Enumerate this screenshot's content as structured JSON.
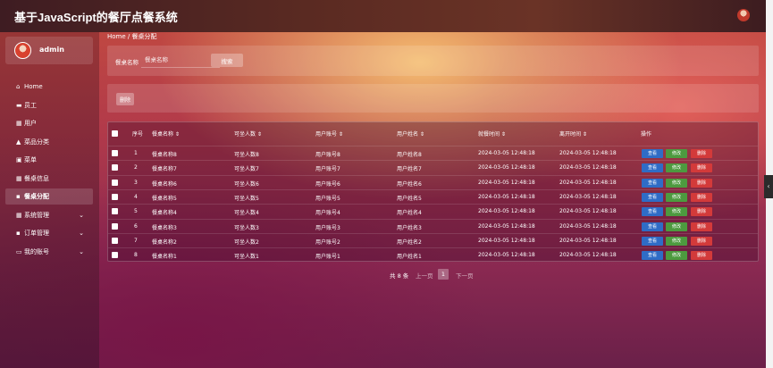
{
  "app": {
    "title": "基于JavaScript的餐厅点餐系统"
  },
  "user": {
    "name": "admin"
  },
  "sidebar": {
    "items": [
      {
        "label": "Home",
        "icon": "home-icon",
        "active": false,
        "expandable": false
      },
      {
        "label": "员工",
        "icon": "staff-icon",
        "active": false,
        "expandable": false
      },
      {
        "label": "用户",
        "icon": "grid-icon",
        "active": false,
        "expandable": false
      },
      {
        "label": "菜品分类",
        "icon": "category-icon",
        "active": false,
        "expandable": false
      },
      {
        "label": "菜单",
        "icon": "menu-icon",
        "active": false,
        "expandable": false
      },
      {
        "label": "餐桌信息",
        "icon": "grid-icon",
        "active": false,
        "expandable": false
      },
      {
        "label": "餐桌分配",
        "icon": "chat-icon",
        "active": true,
        "expandable": false
      },
      {
        "label": "系统管理",
        "icon": "grid-icon",
        "active": false,
        "expandable": true
      },
      {
        "label": "订单管理",
        "icon": "chat-icon",
        "active": false,
        "expandable": true
      },
      {
        "label": "我的账号",
        "icon": "account-icon",
        "active": false,
        "expandable": true
      }
    ]
  },
  "breadcrumb": "Home / 餐桌分配",
  "search": {
    "label": "餐桌名称",
    "placeholder": "餐桌名称",
    "button": "搜索"
  },
  "toolbar": {
    "delete_label": "删除"
  },
  "table": {
    "headers": [
      "序号",
      "餐桌名称 ⇕",
      "可坐人数 ⇕",
      "用户账号 ⇕",
      "用户姓名 ⇕",
      "就餐时间 ⇕",
      "离开时间 ⇕",
      "操作"
    ],
    "action_labels": {
      "view": "查看",
      "edit": "修改",
      "delete": "删除"
    },
    "rows": [
      [
        "1",
        "餐桌名称8",
        "可坐人数8",
        "用户账号8",
        "用户姓名8",
        "2024-03-05 12:48:18",
        "2024-03-05 12:48:18"
      ],
      [
        "2",
        "餐桌名称7",
        "可坐人数7",
        "用户账号7",
        "用户姓名7",
        "2024-03-05 12:48:18",
        "2024-03-05 12:48:18"
      ],
      [
        "3",
        "餐桌名称6",
        "可坐人数6",
        "用户账号6",
        "用户姓名6",
        "2024-03-05 12:48:18",
        "2024-03-05 12:48:18"
      ],
      [
        "4",
        "餐桌名称5",
        "可坐人数5",
        "用户账号5",
        "用户姓名5",
        "2024-03-05 12:48:18",
        "2024-03-05 12:48:18"
      ],
      [
        "5",
        "餐桌名称4",
        "可坐人数4",
        "用户账号4",
        "用户姓名4",
        "2024-03-05 12:48:18",
        "2024-03-05 12:48:18"
      ],
      [
        "6",
        "餐桌名称3",
        "可坐人数3",
        "用户账号3",
        "用户姓名3",
        "2024-03-05 12:48:18",
        "2024-03-05 12:48:18"
      ],
      [
        "7",
        "餐桌名称2",
        "可坐人数2",
        "用户账号2",
        "用户姓名2",
        "2024-03-05 12:48:18",
        "2024-03-05 12:48:18"
      ],
      [
        "8",
        "餐桌名称1",
        "可坐人数1",
        "用户账号1",
        "用户姓名1",
        "2024-03-05 12:48:18",
        "2024-03-05 12:48:18"
      ]
    ]
  },
  "pagination": {
    "total": "共 8 条",
    "prev": "上一页",
    "current": "1",
    "next": "下一页"
  },
  "colors": {
    "view": "#2f6cc6",
    "edit": "#4d9a3f",
    "delete": "#d33a3a"
  }
}
